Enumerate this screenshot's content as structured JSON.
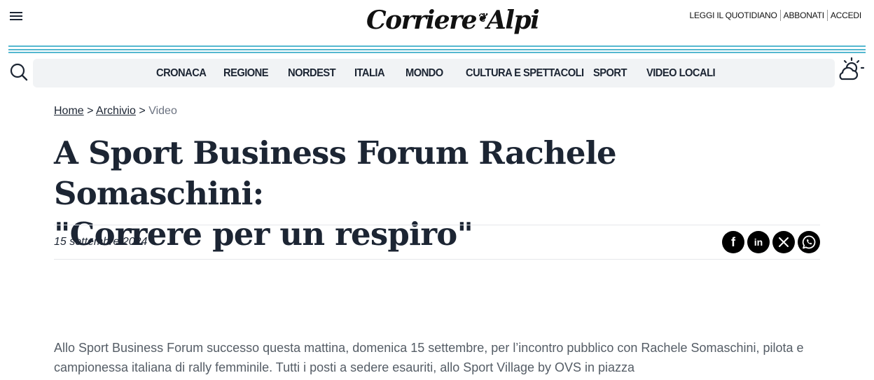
{
  "header": {
    "logo_part1": "Corriere",
    "logo_part2": "Alpi",
    "top_links": [
      "LEGGI IL QUOTIDIANO",
      "ABBONATI",
      "ACCEDI"
    ]
  },
  "nav": {
    "items": [
      "CRONACA",
      "REGIONE",
      "NORDEST",
      "ITALIA",
      "MONDO",
      "CULTURA E SPETTACOLI",
      "SPORT",
      "VIDEO LOCALI"
    ]
  },
  "breadcrumb": {
    "home": "Home",
    "sep": ">",
    "archive": "Archivio",
    "current": "Video"
  },
  "article": {
    "title_line1": "A Sport Business Forum Rachele Somaschini:",
    "title_line2": "\"Correre per un respiro\"",
    "date": "15 settembre 2024",
    "body": "Allo Sport Business Forum successo questa mattina, domenica 15 settembre, per l’incontro pubblico con Rachele Somaschini, pilota e campionessa italiana di rally femminile. Tutti i posti a sedere esauriti, allo Sport Village by OVS in piazza"
  },
  "share": {
    "facebook_glyph": "f",
    "linkedin_glyph": "in"
  },
  "colors": {
    "accent_stripe": "#55b8d0",
    "text": "#1c2533",
    "nav_bg": "#f1f3f5"
  },
  "icons": [
    "menu-icon",
    "search-icon",
    "weather-icon",
    "facebook-icon",
    "linkedin-icon",
    "x-icon",
    "whatsapp-icon"
  ]
}
